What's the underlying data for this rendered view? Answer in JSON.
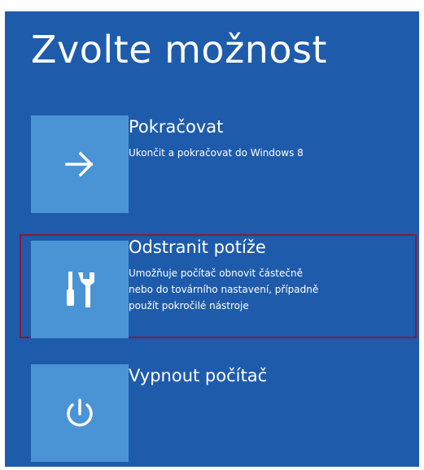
{
  "screen": {
    "title": "Zvolte možnost",
    "background_color": "#1e5bab",
    "tile_color": "#4a94d6",
    "selection_color": "#8a1a33"
  },
  "options": [
    {
      "title": "Pokračovat",
      "description": "Ukončit a pokračovat do Windows 8",
      "icon": "arrow-right-icon",
      "selected": false
    },
    {
      "title": "Odstranit potíže",
      "description": "Umožňuje počítač obnovit částečně\nnebo do továrního nastavení, případně\npoužít pokročilé nástroje",
      "icon": "tools-icon",
      "selected": true
    },
    {
      "title": "Vypnout počítač",
      "description": "",
      "icon": "power-icon",
      "selected": false
    }
  ]
}
